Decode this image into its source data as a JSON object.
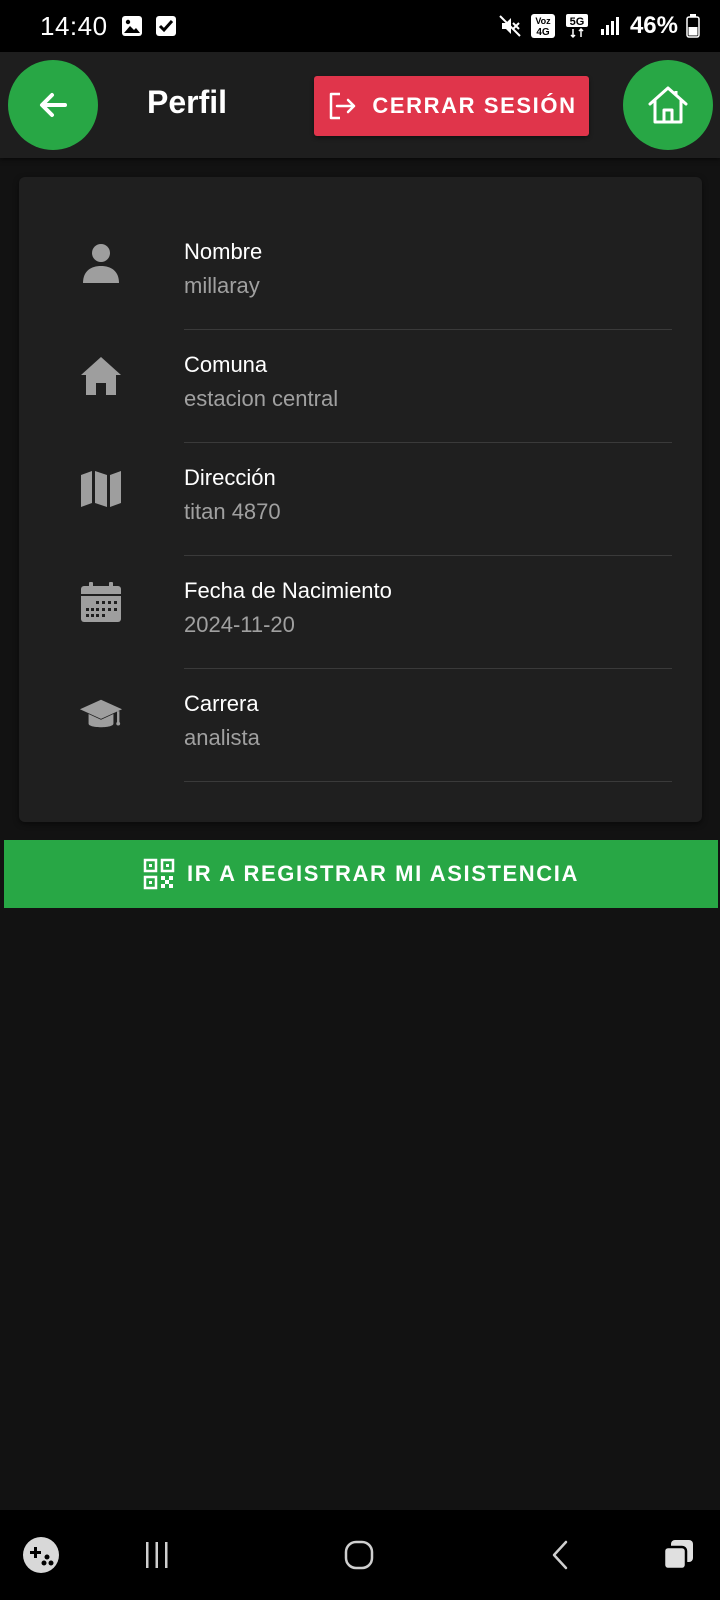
{
  "status_bar": {
    "time": "14:40",
    "battery": "46%",
    "left_icons": [
      "gallery-icon",
      "checkbox-icon"
    ],
    "right_icons": [
      "mute-icon",
      "volte-4g-icon",
      "5g-icon",
      "signal-icon",
      "battery-icon"
    ],
    "network_labels": {
      "volte_top": "Voz",
      "volte_bottom": "4G",
      "fiveg": "5G"
    }
  },
  "app_bar": {
    "title": "Perfil",
    "logout_label": "CERRAR SESIÓN",
    "back_icon": "arrow-left-icon",
    "home_icon": "home-icon"
  },
  "profile": {
    "items": [
      {
        "label": "Nombre",
        "value": "millaray",
        "icon": "person-icon"
      },
      {
        "label": "Comuna",
        "value": "estacion central",
        "icon": "house-icon"
      },
      {
        "label": "Dirección",
        "value": "titan 4870",
        "icon": "map-icon"
      },
      {
        "label": "Fecha de Nacimiento",
        "value": "2024-11-20",
        "icon": "calendar-icon"
      },
      {
        "label": "Carrera",
        "value": "analista",
        "icon": "graduation-cap-icon"
      }
    ]
  },
  "actions": {
    "register_attendance_label": "IR A REGISTRAR MI ASISTENCIA",
    "register_icon": "qr-code-icon"
  },
  "colors": {
    "primary_green": "#28a745",
    "danger_red": "#e0354b",
    "background": "#121212",
    "surface": "#1f1f1f",
    "muted_text": "#a0a0a0"
  },
  "nav_bar": {
    "items": [
      "game-launcher-icon",
      "recents-icon",
      "home-circle-icon",
      "back-chevron-icon",
      "overview-icon"
    ]
  }
}
